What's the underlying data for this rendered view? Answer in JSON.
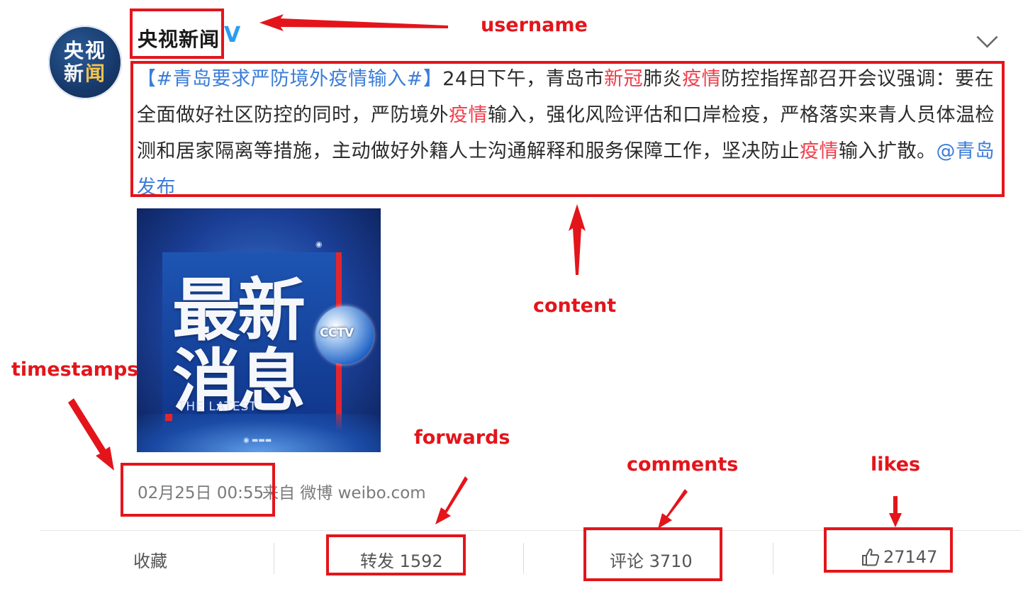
{
  "post": {
    "username": "央视新闻",
    "verified_mark": "V",
    "avatar": {
      "line1": "央视",
      "line2_a": "新",
      "line2_b": "闻"
    },
    "content": {
      "hashtag": "【#青岛要求严防境外疫情输入#】",
      "part1": "24日下午，青岛市",
      "hl1": "新冠",
      "part2": "肺炎",
      "hl2": "疫情",
      "part3": "防控指挥部召开会议强调：要在全面做好社区防控的同时，严防境外",
      "hl3": "疫情",
      "part4": "输入，强化风险评估和口岸检疫，严格落实来青人员体温检测和居家隔离等措施，主动做好外籍人士沟通解释和服务保障工作，坚决防止",
      "hl4": "疫情",
      "part5": "输入扩散。",
      "mention": "@青岛发布"
    },
    "image": {
      "headline_line1": "最新",
      "headline_line2": "消息",
      "subtitle": "THE LATEST",
      "logo_text": "CCTV"
    },
    "timestamp": "02月25日 00:55",
    "source": "来自 微博 weibo.com",
    "actions": {
      "favorite": "收藏",
      "forwards": "转发 1592",
      "comments": "评论 3710",
      "likes": "27147"
    }
  },
  "annotations": {
    "username": "username",
    "content": "content",
    "timestamps": "timestamps",
    "forwards": "forwards",
    "comments": "comments",
    "likes": "likes"
  },
  "colors": {
    "annotation_red": "#e3151b",
    "hashtag_blue": "#3b7dd8",
    "highlight_red": "#ef3d49",
    "verified_blue": "#2b9cf2"
  }
}
